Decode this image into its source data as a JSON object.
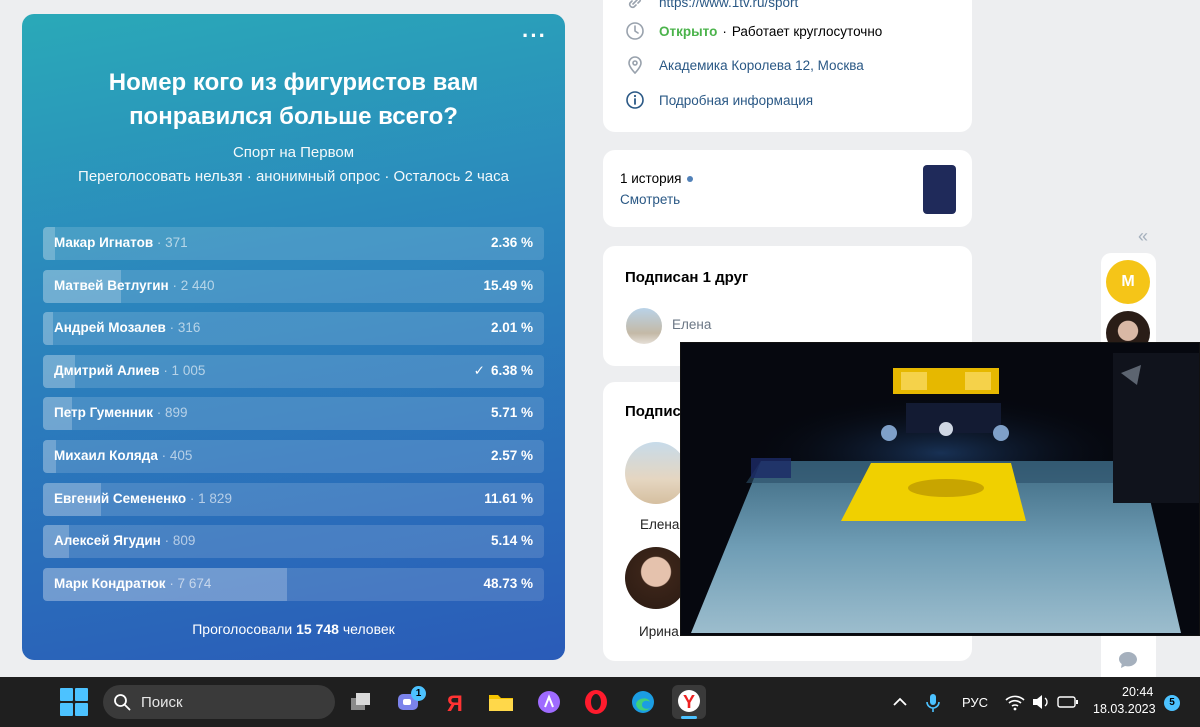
{
  "poll": {
    "title": "Номер кого из фигуристов вам понравился больше всего?",
    "author": "Спорт на Первом",
    "meta": "Переголосовать нельзя · анонимный опрос · Осталось 2 часа",
    "answers": [
      {
        "name": "Макар Игнатов",
        "count": "· 371",
        "percent": "2.36 %",
        "fraction": 0.0236,
        "checked": false
      },
      {
        "name": "Матвей Ветлугин",
        "count": "· 2 440",
        "percent": "15.49 %",
        "fraction": 0.1549,
        "checked": false
      },
      {
        "name": "Андрей Мозалев",
        "count": "· 316",
        "percent": "2.01 %",
        "fraction": 0.0201,
        "checked": false
      },
      {
        "name": "Дмитрий Алиев",
        "count": "· 1 005",
        "percent": "6.38 %",
        "fraction": 0.0638,
        "checked": true
      },
      {
        "name": "Петр Гуменник",
        "count": "· 899",
        "percent": "5.71 %",
        "fraction": 0.0571,
        "checked": false
      },
      {
        "name": "Михаил Коляда",
        "count": "· 405",
        "percent": "2.57 %",
        "fraction": 0.0257,
        "checked": false
      },
      {
        "name": "Евгений Семененко",
        "count": "· 1 829",
        "percent": "11.61 %",
        "fraction": 0.1161,
        "checked": false
      },
      {
        "name": "Алексей Ягудин",
        "count": "· 809",
        "percent": "5.14 %",
        "fraction": 0.0514,
        "checked": false
      },
      {
        "name": "Марк Кондратюк",
        "count": "· 7 674",
        "percent": "48.73 %",
        "fraction": 0.4873,
        "checked": false
      }
    ],
    "total_prefix": "Проголосовали",
    "total_count": "15 748",
    "total_suffix": "человек"
  },
  "info": {
    "link": "https://www.1tv.ru/sport",
    "open_status": "Открыто",
    "hours": "Работает круглосуточно",
    "address": "Академика Королева 12, Москва",
    "details": "Подробная информация"
  },
  "stories": {
    "count_label": "1 история",
    "view_label": "Смотреть"
  },
  "friends": {
    "heading": "Подписан 1 друг",
    "friend_name": "Елена"
  },
  "subscribers": {
    "heading": "Подписч",
    "names": [
      "Елена",
      "Ирина"
    ]
  },
  "rail": {
    "collapse": "«",
    "m_letter": "М"
  },
  "taskbar": {
    "search_placeholder": "Поиск",
    "teams_badge": "1",
    "lang": "РУС",
    "time": "20:44",
    "date": "18.03.2023",
    "notif_count": "5"
  },
  "colors": {
    "accent": "#2a5885",
    "open_green": "#4bb34b",
    "rail_avatar": "#f5c518"
  }
}
